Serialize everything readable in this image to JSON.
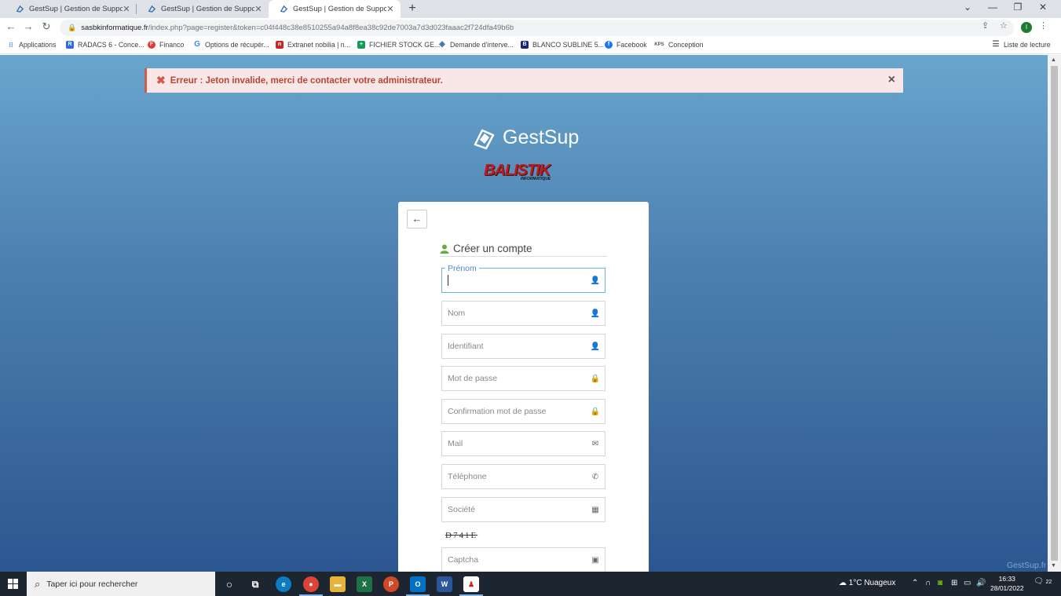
{
  "browser": {
    "tabs": [
      {
        "title": "GestSup | Gestion de Support",
        "close": "✕"
      },
      {
        "title": "GestSup | Gestion de Support",
        "close": "✕"
      },
      {
        "title": "GestSup | Gestion de Support",
        "close": "✕"
      }
    ],
    "new_tab": "+",
    "window_controls": {
      "minimize": "—",
      "restore": "❐",
      "close": "✕"
    },
    "nav": {
      "back": "←",
      "forward": "→",
      "reload": "↻"
    },
    "url_host": "sasbkinformatique.fr",
    "url_path": "/index.php?page=register&token=c04f448c38e8510255a94a8f8ea38c92de7003a7d3d023faaac2f724dfa49b6b",
    "profile_initial": "I",
    "bookmarks": [
      {
        "label": "Applications",
        "icon": "apps-grid-icon",
        "color": "#4285f4"
      },
      {
        "label": "RADACS 6 - Conce...",
        "icon": "radacs-icon",
        "color": "#2d6cdf"
      },
      {
        "label": "Financo",
        "icon": "financo-icon",
        "color": "#e53935"
      },
      {
        "label": "Options de récupér...",
        "icon": "google-icon",
        "color": "#4285f4"
      },
      {
        "label": "Extranet nobilia | n...",
        "icon": "nobilia-icon",
        "color": "#c62828"
      },
      {
        "label": "FICHIER STOCK GE...",
        "icon": "sheets-icon",
        "color": "#0f9d58"
      },
      {
        "label": "Demande d'interve...",
        "icon": "gestsup-icon",
        "color": "#3b6fb6"
      },
      {
        "label": "BLANCO SUBLINE 5...",
        "icon": "blanco-icon",
        "color": "#1a237e"
      },
      {
        "label": "Facebook",
        "icon": "facebook-icon",
        "color": "#1877f2"
      },
      {
        "label": "Conception",
        "icon": "kps-icon",
        "color": "#555555"
      }
    ],
    "reading_list": "Liste de lecture"
  },
  "alert": {
    "message": "Erreur : Jeton invalide, merci de contacter votre administrateur.",
    "close": "×"
  },
  "brand": {
    "name": "GestSup",
    "partner": "BALISTIK",
    "partner_sub": "INFORMATIQUE"
  },
  "form": {
    "title": "Créer un compte",
    "fields": [
      {
        "label": "Prénom",
        "placeholder": "",
        "icon": "user-icon"
      },
      {
        "placeholder": "Nom",
        "icon": "user-icon"
      },
      {
        "placeholder": "Identifiant",
        "icon": "user-icon"
      },
      {
        "placeholder": "Mot de passe",
        "icon": "lock-icon"
      },
      {
        "placeholder": "Confirmation mot de passe",
        "icon": "lock-icon"
      },
      {
        "placeholder": "Mail",
        "icon": "envelope-icon"
      },
      {
        "placeholder": "Téléphone",
        "icon": "phone-icon"
      },
      {
        "placeholder": "Société",
        "icon": "building-icon"
      },
      {
        "placeholder": "Captcha",
        "icon": "image-icon"
      }
    ],
    "captcha_text": "D741E"
  },
  "footer_link": "GestSup.fr",
  "taskbar": {
    "search_placeholder": "Taper ici pour rechercher",
    "weather": "1°C  Nuageux",
    "time": "16:33",
    "date": "28/01/2022",
    "notifications": "22"
  },
  "colors": {
    "accent": "#6fb3e0",
    "error": "#d15b47",
    "user_icon": "#69aa46"
  }
}
